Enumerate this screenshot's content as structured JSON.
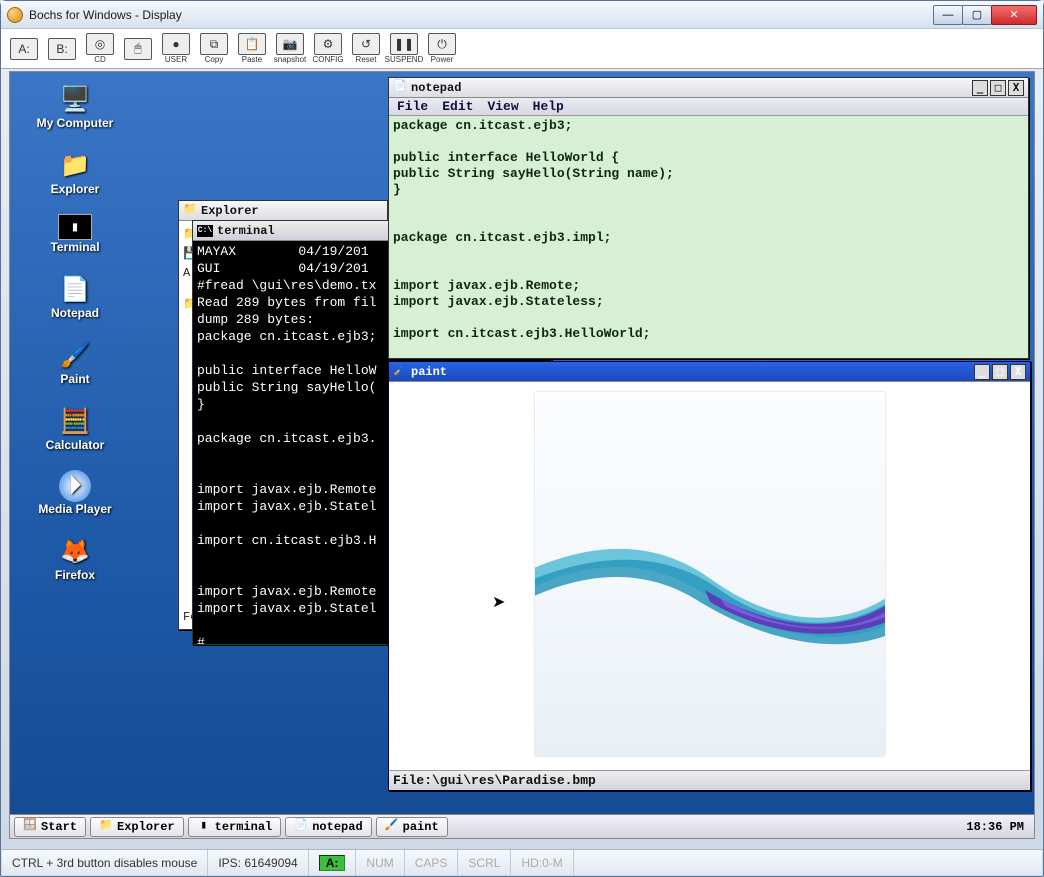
{
  "outer": {
    "title": "Bochs for Windows - Display",
    "min": "—",
    "max": "▢",
    "close": "✕"
  },
  "toolbar": {
    "items": [
      {
        "glyph": "A:",
        "label": ""
      },
      {
        "glyph": "B:",
        "label": ""
      },
      {
        "glyph": "◎",
        "label": "CD"
      },
      {
        "glyph": "🖱",
        "label": ""
      },
      {
        "glyph": "●",
        "label": "USER"
      },
      {
        "glyph": "⧉",
        "label": "Copy"
      },
      {
        "glyph": "📋",
        "label": "Paste"
      },
      {
        "glyph": "📷",
        "label": "snapshot"
      },
      {
        "glyph": "⚙",
        "label": "CONFIG"
      },
      {
        "glyph": "↺",
        "label": "Reset"
      },
      {
        "glyph": "❚❚",
        "label": "SUSPEND"
      },
      {
        "glyph": "⏻",
        "label": "Power"
      }
    ]
  },
  "desktop_icons": [
    {
      "label": "My Computer",
      "glyph": "🖥️"
    },
    {
      "label": "Explorer",
      "glyph": "📁"
    },
    {
      "label": "Terminal",
      "glyph": "▮"
    },
    {
      "label": "Notepad",
      "glyph": "📄"
    },
    {
      "label": "Paint",
      "glyph": "🖌️"
    },
    {
      "label": "Calculator",
      "glyph": "🧮"
    },
    {
      "label": "Media Player",
      "glyph": "⏵"
    },
    {
      "label": "Firefox",
      "glyph": "🦊"
    }
  ],
  "explorer": {
    "title": "Explorer",
    "rows": [
      "F",
      "A"
    ]
  },
  "terminal": {
    "title": "terminal",
    "content": "MAYAX        04/19/201\nGUI          04/19/201\n#fread \\gui\\res\\demo.tx\nRead 289 bytes from fil\ndump 289 bytes:\npackage cn.itcast.ejb3;\n\npublic interface HelloW\npublic String sayHello(\n}\n\npackage cn.itcast.ejb3.\n\n\nimport javax.ejb.Remote\nimport javax.ejb.Statel\n\nimport cn.itcast.ejb3.H\n\n\nimport javax.ejb.Remote\nimport javax.ejb.Statel\n\n#_"
  },
  "notepad": {
    "title": "notepad",
    "menu": [
      "File",
      "Edit",
      "View",
      "Help"
    ],
    "content": "package cn.itcast.ejb3;\n\npublic interface HelloWorld {\npublic String sayHello(String name);\n}\n\n\npackage cn.itcast.ejb3.impl;\n\n\nimport javax.ejb.Remote;\nimport javax.ejb.Stateless;\n\nimport cn.itcast.ejb3.HelloWorld;"
  },
  "paint": {
    "title": "paint",
    "status": "File:\\gui\\res\\Paradise.bmp"
  },
  "taskbar": {
    "start": "Start",
    "items": [
      {
        "icon": "📁",
        "label": "Explorer"
      },
      {
        "icon": "▮",
        "label": "terminal"
      },
      {
        "icon": "📄",
        "label": "notepad"
      },
      {
        "icon": "🖌️",
        "label": "paint"
      }
    ],
    "clock": "18:36 PM"
  },
  "statusbar": {
    "mouse": "CTRL + 3rd button disables mouse",
    "ips": "IPS: 61649094",
    "a": "A:",
    "num": "NUM",
    "caps": "CAPS",
    "scrl": "SCRL",
    "hd": "HD:0-M"
  },
  "sub_controls": {
    "min": "_",
    "max": "□",
    "close": "X"
  }
}
